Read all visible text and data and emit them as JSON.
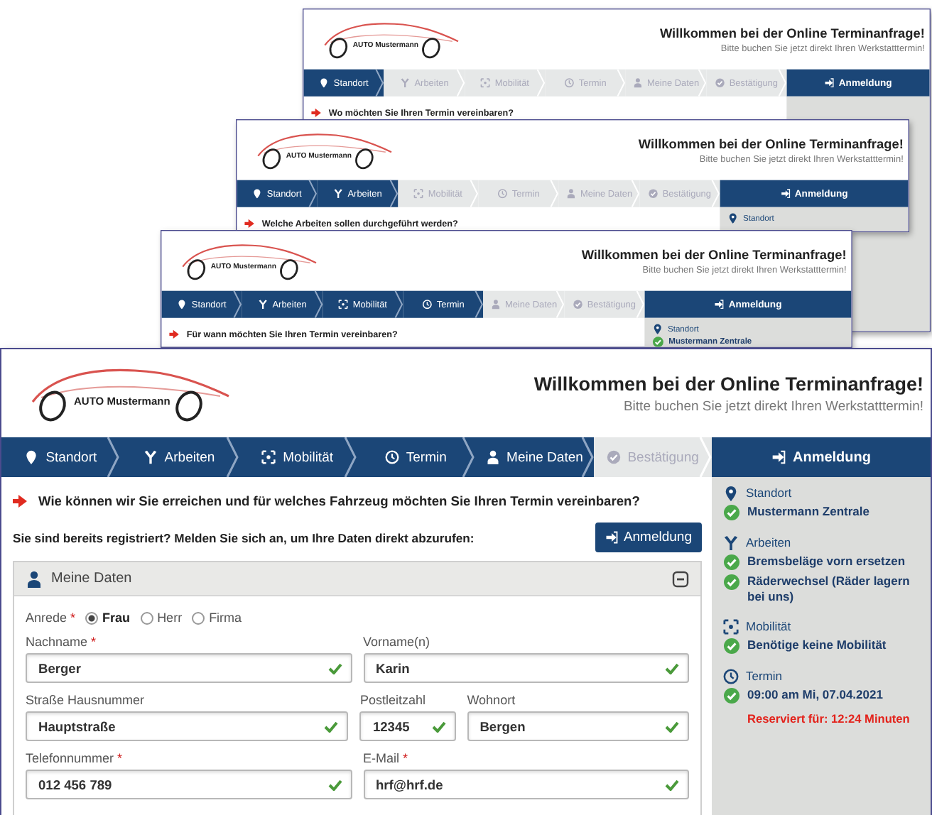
{
  "screens": [
    {
      "logo": "AUTO Mustermann",
      "title": "Willkommen bei der Online Terminanfrage!",
      "subtitle": "Bitte buchen Sie jetzt direkt Ihren Werkstatttermin!",
      "login_header": "Anmeldung",
      "question": "Wo möchten Sie Ihren Termin vereinbaren?",
      "steps": [
        {
          "kind": "location",
          "label": "Standort",
          "done": true
        },
        {
          "kind": "tools",
          "label": "Arbeiten",
          "done": false
        },
        {
          "kind": "mobility",
          "label": "Mobilität",
          "done": false
        },
        {
          "kind": "time",
          "label": "Termin",
          "done": false
        },
        {
          "kind": "person",
          "label": "Meine Daten",
          "done": false
        },
        {
          "kind": "check",
          "label": "Bestätigung",
          "done": false
        }
      ]
    },
    {
      "logo": "AUTO Mustermann",
      "title": "Willkommen bei der Online Terminanfrage!",
      "subtitle": "Bitte buchen Sie jetzt direkt Ihren Werkstatttermin!",
      "login_header": "Anmeldung",
      "question": "Welche Arbeiten sollen durchgeführt werden?",
      "steps": [
        {
          "kind": "location",
          "label": "Standort",
          "done": true
        },
        {
          "kind": "tools",
          "label": "Arbeiten",
          "done": true
        },
        {
          "kind": "mobility",
          "label": "Mobilität",
          "done": false
        },
        {
          "kind": "time",
          "label": "Termin",
          "done": false
        },
        {
          "kind": "person",
          "label": "Meine Daten",
          "done": false
        },
        {
          "kind": "check",
          "label": "Bestätigung",
          "done": false
        }
      ],
      "summary": [
        {
          "kind": "location",
          "label": "Standort"
        }
      ]
    },
    {
      "logo": "AUTO Mustermann",
      "title": "Willkommen bei der Online Terminanfrage!",
      "subtitle": "Bitte buchen Sie jetzt direkt Ihren Werkstatttermin!",
      "login_header": "Anmeldung",
      "question": "Für wann möchten Sie Ihren Termin vereinbaren?",
      "steps": [
        {
          "kind": "location",
          "label": "Standort",
          "done": true
        },
        {
          "kind": "tools",
          "label": "Arbeiten",
          "done": true
        },
        {
          "kind": "mobility",
          "label": "Mobilität",
          "done": true
        },
        {
          "kind": "time",
          "label": "Termin",
          "done": true
        },
        {
          "kind": "person",
          "label": "Meine Daten",
          "done": false
        },
        {
          "kind": "check",
          "label": "Bestätigung",
          "done": false
        }
      ],
      "summary": [
        {
          "kind": "location",
          "label": "Standort",
          "items": [
            "Mustermann Zentrale"
          ]
        }
      ]
    },
    {
      "logo": "AUTO Mustermann",
      "title": "Willkommen bei der Online Terminanfrage!",
      "subtitle": "Bitte buchen Sie jetzt direkt Ihren Werkstatttermin!",
      "login_header": "Anmeldung",
      "question": "Wie können wir Sie erreichen und für welches Fahrzeug möchten Sie Ihren Termin vereinbaren?",
      "steps": [
        {
          "kind": "location",
          "label": "Standort",
          "done": true
        },
        {
          "kind": "tools",
          "label": "Arbeiten",
          "done": true
        },
        {
          "kind": "mobility",
          "label": "Mobilität",
          "done": true
        },
        {
          "kind": "time",
          "label": "Termin",
          "done": true
        },
        {
          "kind": "person",
          "label": "Meine Daten",
          "done": true
        },
        {
          "kind": "check",
          "label": "Bestätigung",
          "done": false
        }
      ],
      "summary": [
        {
          "kind": "location",
          "label": "Standort",
          "items": [
            "Mustermann Zentrale"
          ]
        },
        {
          "kind": "tools",
          "label": "Arbeiten",
          "items": [
            "Bremsbeläge vorn ersetzen",
            "Räderwechsel (Räder lagern bei uns)"
          ]
        },
        {
          "kind": "mobility",
          "label": "Mobilität",
          "items": [
            "Benötige keine Mobilität"
          ]
        },
        {
          "kind": "time",
          "label": "Termin",
          "items": [
            "09:00 am Mi, 07.04.2021"
          ],
          "note": "Reserviert für: 12:24 Minuten"
        }
      ],
      "login_prompt": "Sie sind bereits registriert? Melden Sie sich an, um Ihre Daten direkt abzurufen:",
      "login_button": "Anmeldung",
      "form": {
        "title": "Meine Daten",
        "salutation": {
          "label": "Anrede",
          "required_mark": "*",
          "options": [
            {
              "label": "Frau",
              "selected": true
            },
            {
              "label": "Herr",
              "selected": false
            },
            {
              "label": "Firma",
              "selected": false
            }
          ]
        },
        "rows": [
          [
            {
              "label": "Nachname",
              "required_mark": "*",
              "value": "Berger",
              "valid": true
            },
            {
              "label": "Vorname(n)",
              "value": "Karin",
              "valid": true
            }
          ],
          [
            {
              "label": "Straße Hausnummer",
              "value": "Hauptstraße",
              "valid": true
            },
            {
              "label": "Postleitzahl",
              "value": "12345",
              "valid": true
            },
            {
              "label": "Wohnort",
              "value": "Bergen",
              "valid": true
            }
          ],
          [
            {
              "label": "Telefonnummer",
              "required_mark": "*",
              "value": "012 456 789",
              "valid": true
            },
            {
              "label": "E-Mail",
              "required_mark": "*",
              "value": "hrf@hrf.de",
              "valid": true
            }
          ]
        ]
      }
    }
  ]
}
